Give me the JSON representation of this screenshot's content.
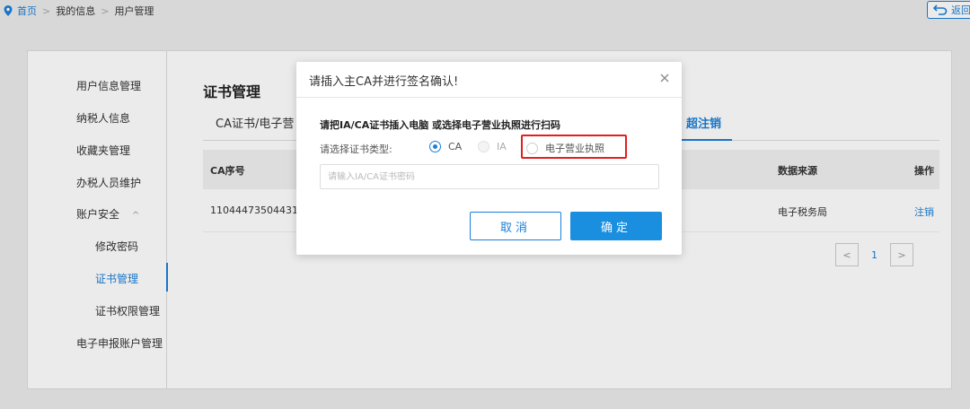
{
  "breadcrumb": {
    "home": "首页",
    "sep": ">",
    "level2": "我的信息",
    "level3": "用户管理"
  },
  "back_button": {
    "label": "返回"
  },
  "sidebar": {
    "items": [
      {
        "label": "用户信息管理"
      },
      {
        "label": "纳税人信息"
      },
      {
        "label": "收藏夹管理"
      },
      {
        "label": "办税人员维护"
      },
      {
        "label": "账户安全",
        "chevron": "^"
      },
      {
        "label": "修改密码"
      },
      {
        "label": "证书管理"
      },
      {
        "label": "证书权限管理"
      },
      {
        "label": "电子申报账户管理"
      }
    ]
  },
  "main": {
    "title": "证书管理",
    "tabs": {
      "first": "CA证书/电子营",
      "active": "超注销"
    },
    "table": {
      "headers": {
        "serial": "CA序号",
        "source": "数据来源",
        "action": "操作"
      },
      "row": {
        "serial": "110444735044312",
        "source": "电子税务局",
        "action": "注销"
      }
    },
    "pager": {
      "prev": "<",
      "page": "1",
      "next": ">"
    }
  },
  "modal": {
    "title": "请插入主CA并进行签名确认!",
    "close": "×",
    "instruction": "请把IA/CA证书插入电脑 或选择电子营业执照进行扫码",
    "type_label": "请选择证书类型:",
    "options": [
      {
        "label": "CA",
        "state": "checked"
      },
      {
        "label": "IA",
        "state": "disabled"
      },
      {
        "label": "电子营业执照",
        "state": "unchecked"
      }
    ],
    "password_placeholder": "请输入IA/CA证书密码",
    "cancel_label": "取消",
    "ok_label": "确定"
  },
  "colors": {
    "accent": "#1a7fd8",
    "highlight": "#e02020",
    "primary_button": "#1a8fe0"
  }
}
